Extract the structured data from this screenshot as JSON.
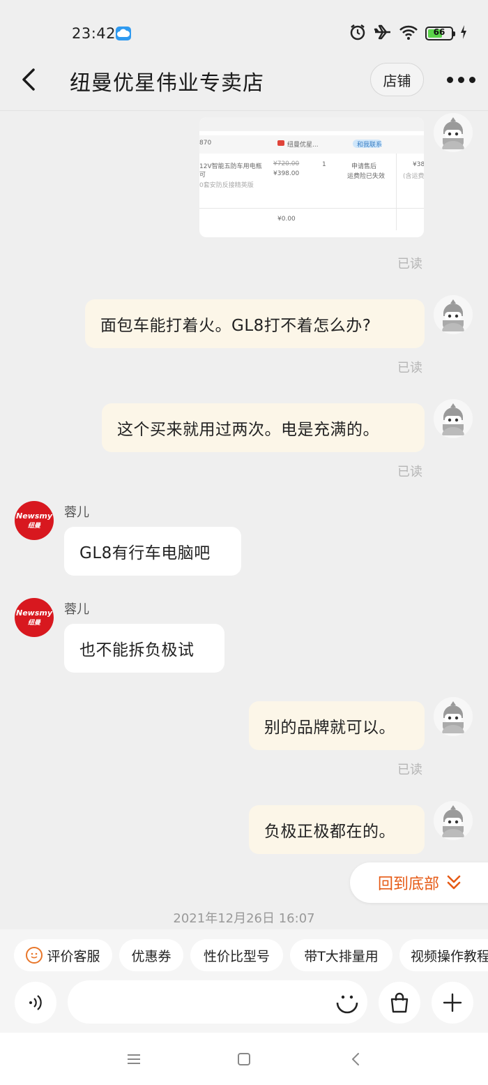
{
  "status_bar": {
    "time": "23:42",
    "battery_level": "66",
    "battery_fraction": 0.66,
    "icons": [
      "cloud-icon",
      "alarm-icon",
      "airplane-icon",
      "wifi-icon",
      "battery-icon",
      "charging-icon"
    ]
  },
  "header": {
    "title": "纽曼优星伟业专卖店",
    "store_label": "店铺",
    "back_icon": "back-arrow-icon",
    "more_icon": "more-dots-icon"
  },
  "screenshot_card": {
    "code": "870",
    "shop_tag": "纽曼优星...",
    "contact_tag": "和我联系",
    "product_line1": "12V智能五防车用电瓶",
    "product_line2": "可",
    "product_line3": "0套安防反接精英版",
    "price_original": "¥720.00",
    "price_now": "¥398.00",
    "qty": "1",
    "status_line1": "申请售后",
    "status_line2": "运费险已失效",
    "total": "¥38",
    "total_note": "(含运费",
    "zero": "¥0.00"
  },
  "messages": [
    {
      "from": "me",
      "type": "image",
      "read": "已读"
    },
    {
      "from": "me",
      "text": "面包车能打着火。GL8打不着怎么办?",
      "read": "已读"
    },
    {
      "from": "me",
      "text": "这个买来就用过两次。电是充满的。",
      "read": "已读"
    },
    {
      "from": "shop",
      "sender": "蓉儿",
      "text": "GL8有行车电脑吧"
    },
    {
      "from": "shop",
      "sender": "蓉儿",
      "text": "也不能拆负极试"
    },
    {
      "from": "me",
      "text": "别的品牌就可以。",
      "read": "已读"
    },
    {
      "from": "me",
      "text": "负极正极都在的。"
    }
  ],
  "shop_avatar": {
    "brand": "Newsmy",
    "brand_cn": "纽曼"
  },
  "scroll_to_bottom": "回到底部",
  "timestamp": "2021年12月26日 16:07",
  "quick_chips": [
    "评价客服",
    "优惠券",
    "性价比型号",
    "带T大排量用",
    "视频操作教程"
  ],
  "input": {
    "placeholder": ""
  },
  "colors": {
    "accent": "#e65a15",
    "my_bubble": "#fcf6e8",
    "shop_red": "#d8181f"
  }
}
